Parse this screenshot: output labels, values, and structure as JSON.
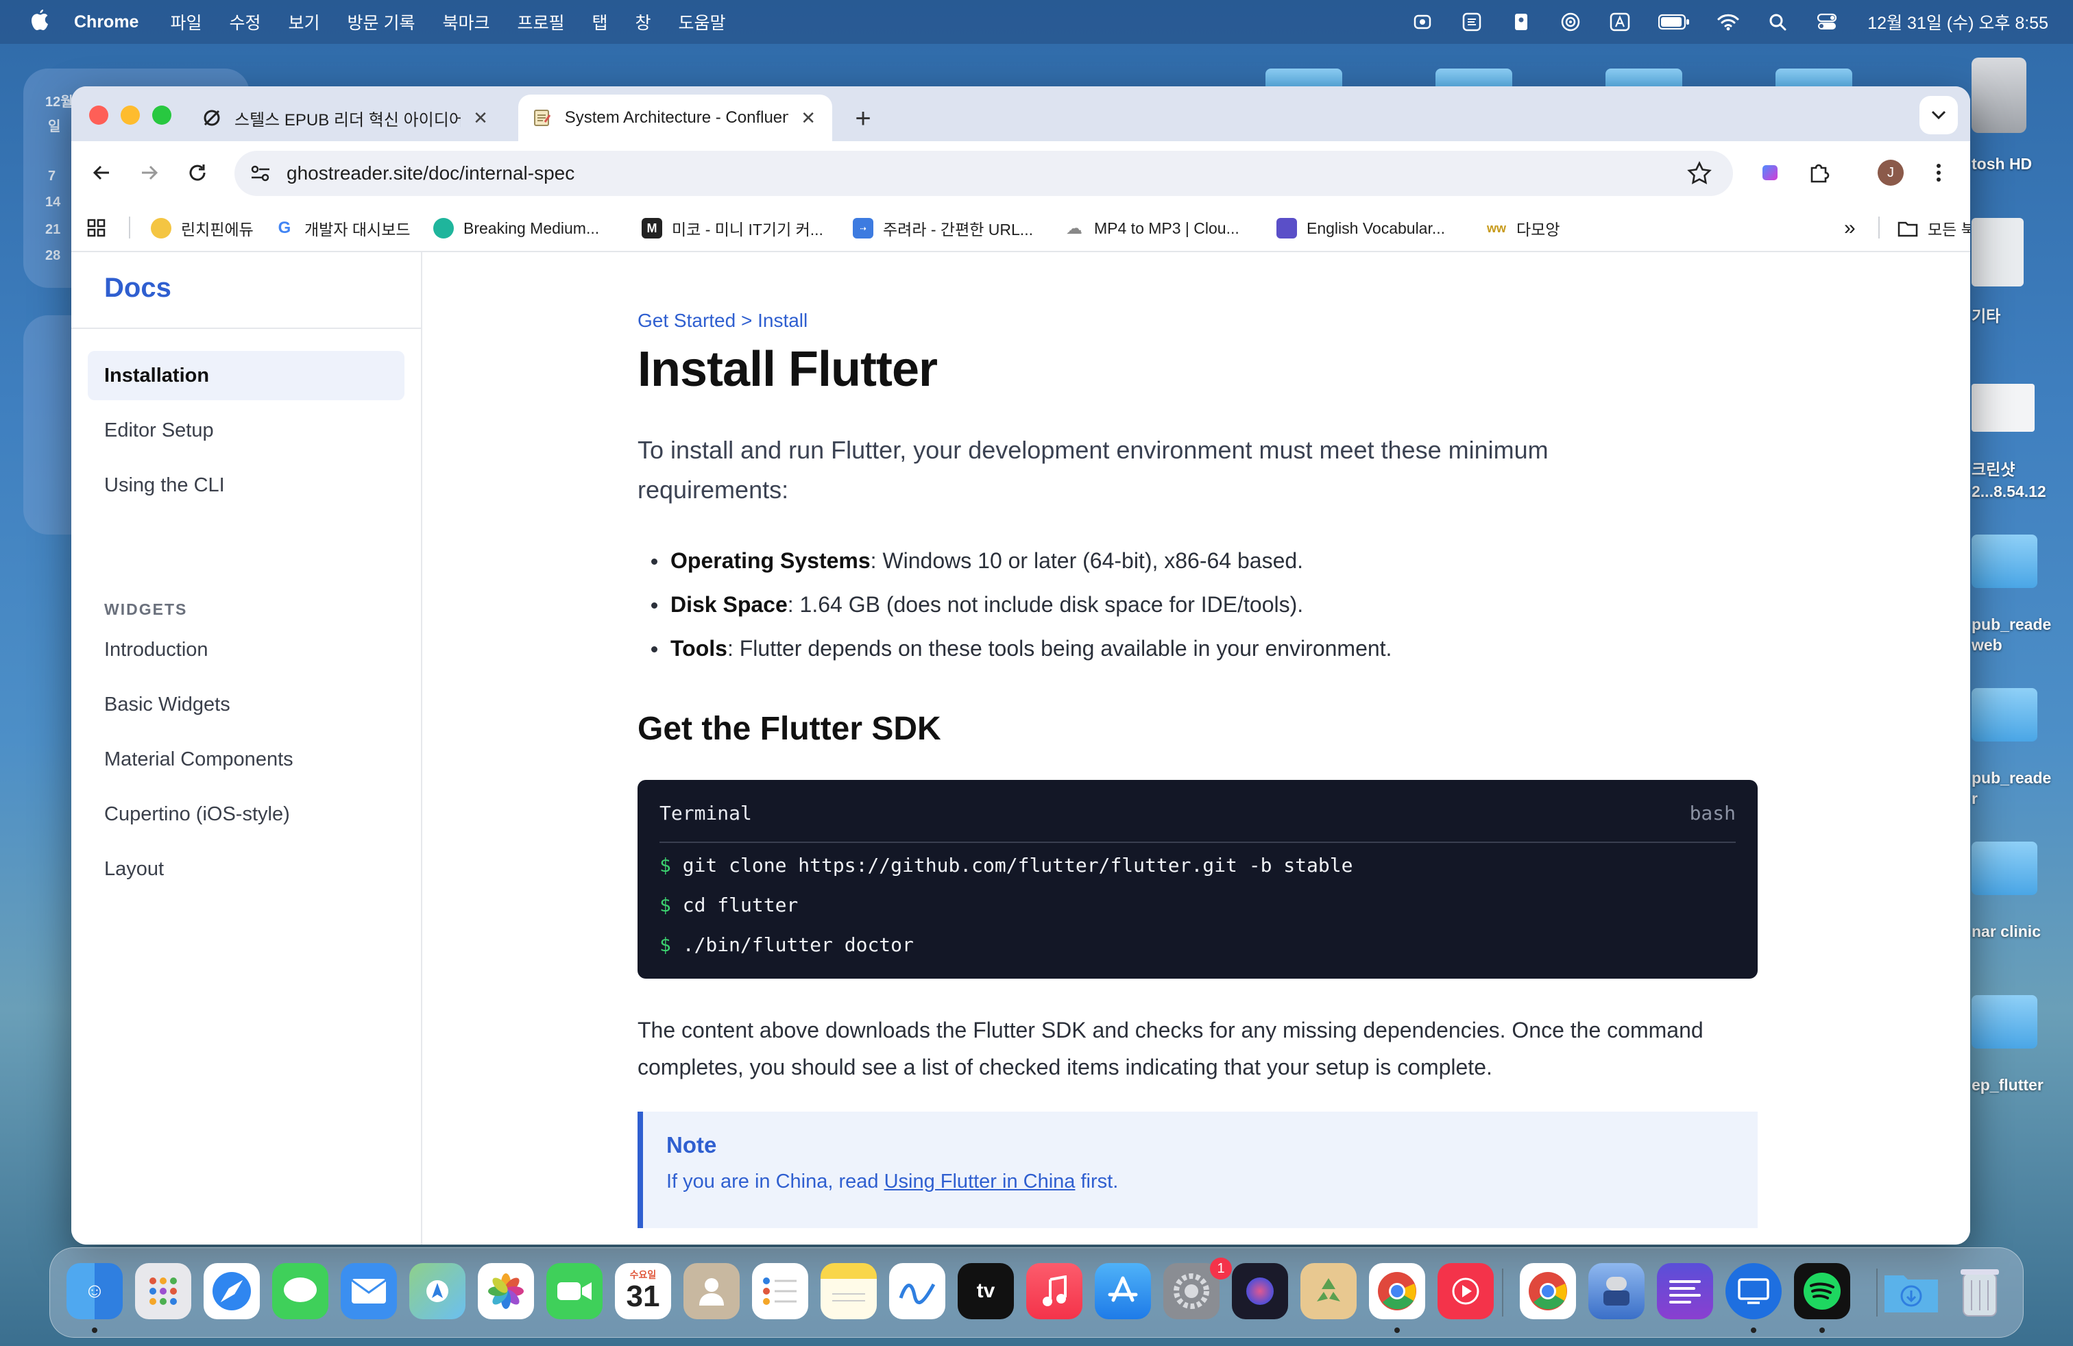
{
  "menubar": {
    "app_name": "Chrome",
    "menus": [
      "파일",
      "수정",
      "보기",
      "방문 기록",
      "북마크",
      "프로필",
      "탭",
      "창",
      "도움말"
    ],
    "clock": "12월 31일 (수) 오후 8:55"
  },
  "desktop": {
    "widget_month": "12월",
    "widget_day_label": "일",
    "widget_dates": [
      "7",
      "14",
      "21",
      "28"
    ],
    "items": [
      {
        "label": "tosh HD"
      },
      {
        "label": "기타"
      },
      {
        "label": "크린샷"
      },
      {
        "label": "2...8.54.12"
      },
      {
        "label": "pub_reade"
      },
      {
        "label": "web"
      },
      {
        "label": "pub_reade"
      },
      {
        "label": "r"
      },
      {
        "label": "nar clinic"
      },
      {
        "label": "ep_flutter"
      }
    ]
  },
  "browser": {
    "tabs": [
      {
        "title": "스텔스 EPUB 리더 혁신 아이디어",
        "icon": "openai-icon",
        "active": false
      },
      {
        "title": "System Architecture - Confluence",
        "icon": "notepad-icon",
        "active": true
      }
    ],
    "new_tab": "+",
    "close_glyph": "✕",
    "url": "ghostreader.site/doc/internal-spec",
    "profile_initial": "J",
    "bookmarks": [
      {
        "label": "린치핀에듀",
        "color": "#f4c542"
      },
      {
        "label": "개발자 대시보드",
        "color": "#4285f4"
      },
      {
        "label": "Breaking Medium...",
        "color": "#1fb59c"
      },
      {
        "label": "미코 - 미니 IT기기 커...",
        "color": "#222222"
      },
      {
        "label": "주려라 - 간편한 URL...",
        "color": "#3d7be0"
      },
      {
        "label": "MP4 to MP3 | Clou...",
        "color": "#888888"
      },
      {
        "label": "English Vocabular...",
        "color": "#5a4fc8"
      },
      {
        "label": "다모앙",
        "color": "#c79a1a"
      }
    ],
    "bookmarks_more": "»",
    "all_bookmarks": "모든 북마크"
  },
  "docs": {
    "brand": "Docs",
    "nav": [
      {
        "label": "Installation",
        "active": true
      },
      {
        "label": "Editor Setup",
        "active": false
      },
      {
        "label": "Using the CLI",
        "active": false
      }
    ],
    "section_widgets": "WIDGETS",
    "nav_widgets": [
      {
        "label": "Introduction"
      },
      {
        "label": "Basic Widgets"
      },
      {
        "label": "Material Components"
      },
      {
        "label": "Cupertino (iOS-style)"
      },
      {
        "label": "Layout"
      }
    ],
    "breadcrumb": "Get Started > Install",
    "title": "Install Flutter",
    "lead": "To install and run Flutter, your development environment must meet these minimum requirements:",
    "requirements": [
      {
        "term": "Operating Systems",
        "text": ": Windows 10 or later (64-bit), x86-64 based."
      },
      {
        "term": "Disk Space",
        "text": ": 1.64 GB (does not include disk space for IDE/tools)."
      },
      {
        "term": "Tools",
        "text": ": Flutter depends on these tools being available in your environment."
      }
    ],
    "sdk_heading": "Get the Flutter SDK",
    "terminal": {
      "label": "Terminal",
      "lang": "bash",
      "prompt": "$",
      "lines": [
        "git clone https://github.com/flutter/flutter.git -b stable",
        "cd flutter",
        "./bin/flutter doctor"
      ]
    },
    "after_text": "The content above downloads the Flutter SDK and checks for any missing dependencies. Once the command completes, you should see a list of checked items indicating that your setup is complete.",
    "note": {
      "title": "Note",
      "prefix": "If you are in China, read ",
      "link": "Using Flutter in China",
      "suffix": " first."
    }
  },
  "dock": {
    "calendar_weekday": "수요일",
    "calendar_day": "31",
    "settings_badge": "1",
    "tv_label": "tv",
    "apps": [
      "finder",
      "launchpad",
      "safari",
      "messages",
      "mail",
      "maps",
      "photos",
      "facetime",
      "calendar",
      "contacts",
      "reminders",
      "notes",
      "freeform",
      "tv",
      "music",
      "app-store",
      "system-settings",
      "arc",
      "recycle",
      "chrome",
      "youtube-music",
      "chrome-2",
      "automator",
      "linear",
      "remote-desktop",
      "spotify",
      "downloads",
      "trash"
    ]
  }
}
